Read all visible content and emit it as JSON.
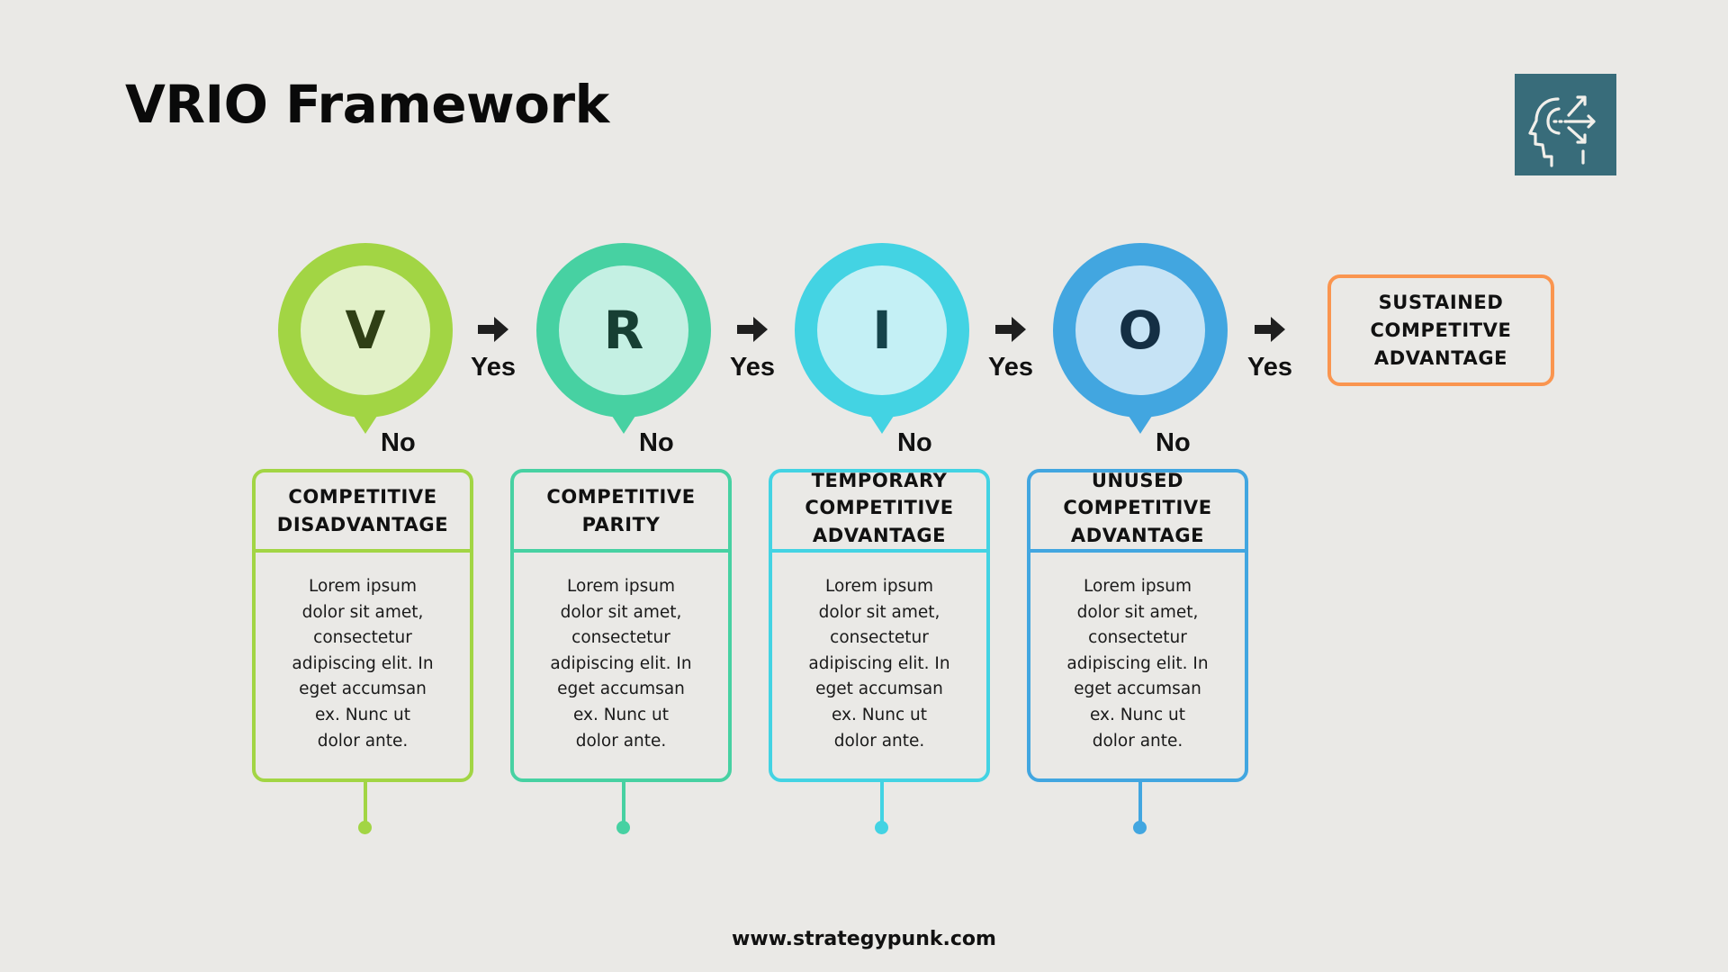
{
  "header": {
    "title": "VRIO Framework",
    "logo_icon": "head-decision-arrows-icon",
    "logo_color": "#386C7A"
  },
  "flow": {
    "yes_label": "Yes",
    "no_label": "No",
    "arrow_icon": "right-arrow-icon",
    "steps": [
      {
        "letter": "V",
        "ring_color": "#A2D544",
        "inner_color": "#E2F1C8",
        "letter_color": "#2F3F15",
        "outcome_title_lines": [
          "COMPETITIVE",
          "DISADVANTAGE"
        ],
        "description_lines": [
          "Lorem ipsum",
          "dolor sit amet,",
          "consectetur",
          "adipiscing elit. In",
          "eget accumsan",
          "ex. Nunc ut",
          "dolor ante."
        ]
      },
      {
        "letter": "R",
        "ring_color": "#47D1A2",
        "inner_color": "#C4F0E3",
        "letter_color": "#173F33",
        "outcome_title_lines": [
          "COMPETITIVE",
          "PARITY"
        ],
        "description_lines": [
          "Lorem ipsum",
          "dolor sit amet,",
          "consectetur",
          "adipiscing elit. In",
          "eget accumsan",
          "ex. Nunc ut",
          "dolor ante."
        ]
      },
      {
        "letter": "I",
        "ring_color": "#43D3E3",
        "inner_color": "#C4F0F5",
        "letter_color": "#15434A",
        "outcome_title_lines": [
          "TEMPORARY",
          "COMPETITIVE",
          "ADVANTAGE"
        ],
        "description_lines": [
          "Lorem ipsum",
          "dolor sit amet,",
          "consectetur",
          "adipiscing elit. In",
          "eget accumsan",
          "ex. Nunc ut",
          "dolor ante."
        ]
      },
      {
        "letter": "O",
        "ring_color": "#42A6E0",
        "inner_color": "#C6E3F5",
        "letter_color": "#142F44",
        "outcome_title_lines": [
          "UNUSED",
          "COMPETITIVE",
          "ADVANTAGE"
        ],
        "description_lines": [
          "Lorem ipsum",
          "dolor sit amet,",
          "consectetur",
          "adipiscing elit. In",
          "eget accumsan",
          "ex. Nunc ut",
          "dolor ante."
        ]
      }
    ],
    "final_outcome": {
      "title_lines": [
        "SUSTAINED",
        "COMPETITVE",
        "ADVANTAGE"
      ],
      "border_color": "#FA954F"
    }
  },
  "footer": {
    "website": "www.strategypunk.com"
  }
}
